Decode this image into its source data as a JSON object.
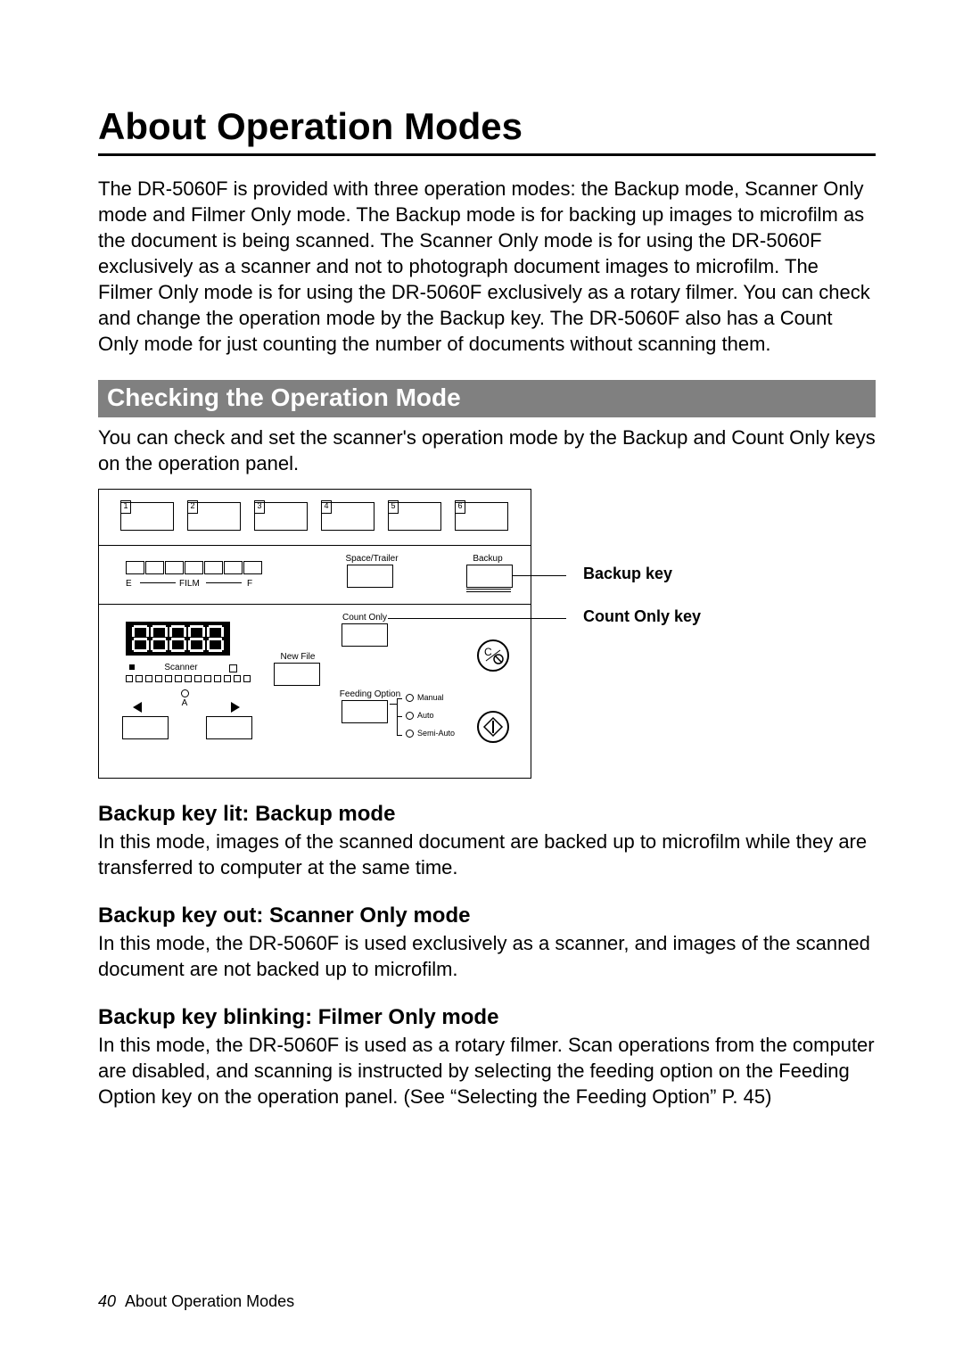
{
  "title": "About Operation Modes",
  "intro": "The DR-5060F is provided with three operation modes: the Backup mode, Scanner Only mode and Filmer Only mode. The Backup mode is for backing up images to microfilm as the document is being scanned. The Scanner Only mode is for using the DR-5060F exclusively as a scanner and not to photograph document images to microfilm. The Filmer Only mode is for using the DR-5060F exclusively as a rotary filmer. You can check and change the operation mode by the Backup key. The DR-5060F also has a Count Only mode for just counting the number of documents without scanning them.",
  "section_heading": "Checking the Operation Mode",
  "section_intro": "You can check and set the scanner's operation mode by the Backup and Count Only keys on the operation panel.",
  "panel": {
    "num_keys": [
      "1",
      "2",
      "3",
      "4",
      "5",
      "6"
    ],
    "film_left": "E",
    "film_mid": "FILM",
    "film_right": "F",
    "space_trailer": "Space/Trailer",
    "backup": "Backup",
    "count_only": "Count Only",
    "new_file": "New File",
    "scanner": "Scanner",
    "a": "A",
    "feeding_option": "Feeding Option",
    "feed_manual": "Manual",
    "feed_auto": "Auto",
    "feed_semi": "Semi-Auto",
    "display_digits": 5
  },
  "callouts": {
    "backup_key": "Backup key",
    "count_only_key": "Count Only key"
  },
  "modes": [
    {
      "heading": "Backup key lit: Backup mode",
      "body": "In this mode, images of the scanned document are backed up to microfilm while they are transferred to computer at the same time."
    },
    {
      "heading": "Backup key out: Scanner Only mode",
      "body": "In this mode, the DR-5060F is used exclusively as a scanner, and images of the scanned document are not backed up to microfilm."
    },
    {
      "heading": "Backup key blinking: Filmer Only mode",
      "body": "In this mode, the DR-5060F is used as a rotary filmer. Scan operations from the computer are disabled, and scanning is instructed by selecting the feeding option on the Feeding Option key on the operation panel. (See “Selecting the Feeding Option” P. 45)"
    }
  ],
  "footer": {
    "page_number": "40",
    "section": "About Operation Modes"
  }
}
